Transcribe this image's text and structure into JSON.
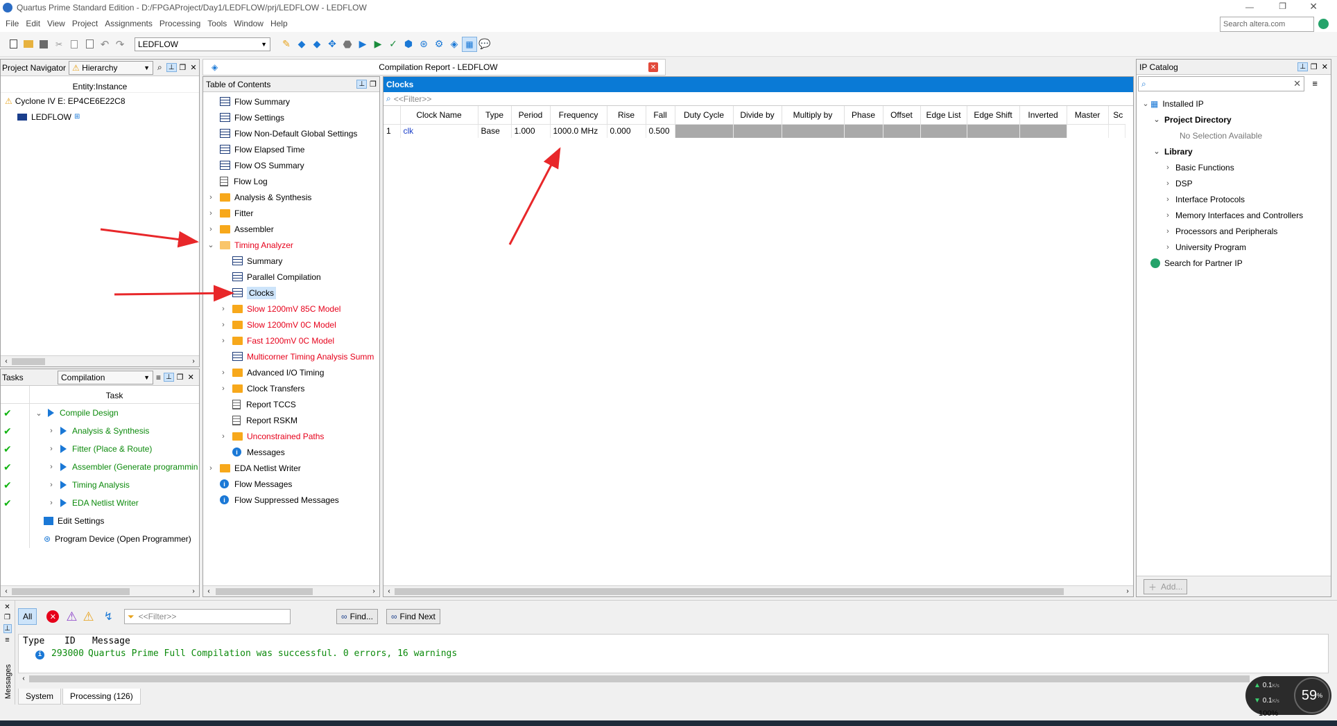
{
  "window": {
    "title": "Quartus Prime Standard Edition - D:/FPGAProject/Day1/LEDFLOW/prj/LEDFLOW - LEDFLOW",
    "search_placeholder": "Search altera.com"
  },
  "menu": [
    "File",
    "Edit",
    "View",
    "Project",
    "Assignments",
    "Processing",
    "Tools",
    "Window",
    "Help"
  ],
  "toolbar": {
    "project_select": "LEDFLOW"
  },
  "navigator": {
    "label": "Project Navigator",
    "view_select": "Hierarchy",
    "column": "Entity:Instance",
    "device": "Cyclone IV E: EP4CE6E22C8",
    "top": "LEDFLOW"
  },
  "tasks": {
    "label": "Tasks",
    "flow_select": "Compilation",
    "column": "Task",
    "items": [
      {
        "label": "Compile Design",
        "done": true,
        "level": 0
      },
      {
        "label": "Analysis & Synthesis",
        "done": true,
        "level": 1
      },
      {
        "label": "Fitter (Place & Route)",
        "done": true,
        "level": 1
      },
      {
        "label": "Assembler (Generate programmin",
        "done": true,
        "level": 1
      },
      {
        "label": "Timing Analysis",
        "done": true,
        "level": 1
      },
      {
        "label": "EDA Netlist Writer",
        "done": true,
        "level": 1
      },
      {
        "label": "Edit Settings",
        "done": false,
        "level": 0
      },
      {
        "label": "Program Device (Open Programmer)",
        "done": false,
        "level": 0
      }
    ]
  },
  "report": {
    "tab_title": "Compilation Report - LEDFLOW",
    "toc_title": "Table of Contents",
    "toc": [
      {
        "label": "Flow Summary",
        "icon": "table",
        "level": 0
      },
      {
        "label": "Flow Settings",
        "icon": "table",
        "level": 0
      },
      {
        "label": "Flow Non-Default Global Settings",
        "icon": "table",
        "level": 0
      },
      {
        "label": "Flow Elapsed Time",
        "icon": "table",
        "level": 0
      },
      {
        "label": "Flow OS Summary",
        "icon": "table",
        "level": 0
      },
      {
        "label": "Flow Log",
        "icon": "doc",
        "level": 0
      },
      {
        "label": "Analysis & Synthesis",
        "icon": "folder",
        "level": 0,
        "chev": "›"
      },
      {
        "label": "Fitter",
        "icon": "folder",
        "level": 0,
        "chev": "›"
      },
      {
        "label": "Assembler",
        "icon": "folder",
        "level": 0,
        "chev": "›"
      },
      {
        "label": "Timing Analyzer",
        "icon": "folder-open",
        "level": 0,
        "chev": "⌄",
        "red": true
      },
      {
        "label": "Summary",
        "icon": "table",
        "level": 1
      },
      {
        "label": "Parallel Compilation",
        "icon": "table",
        "level": 1
      },
      {
        "label": "Clocks",
        "icon": "table",
        "level": 1,
        "selected": true
      },
      {
        "label": "Slow 1200mV 85C Model",
        "icon": "folder",
        "level": 1,
        "chev": "›",
        "red": true
      },
      {
        "label": "Slow 1200mV 0C Model",
        "icon": "folder",
        "level": 1,
        "chev": "›",
        "red": true
      },
      {
        "label": "Fast 1200mV 0C Model",
        "icon": "folder",
        "level": 1,
        "chev": "›",
        "red": true
      },
      {
        "label": "Multicorner Timing Analysis Summ",
        "icon": "table",
        "level": 1,
        "red": true
      },
      {
        "label": "Advanced I/O Timing",
        "icon": "folder",
        "level": 1,
        "chev": "›"
      },
      {
        "label": "Clock Transfers",
        "icon": "folder",
        "level": 1,
        "chev": "›"
      },
      {
        "label": "Report TCCS",
        "icon": "doc",
        "level": 1
      },
      {
        "label": "Report RSKM",
        "icon": "doc",
        "level": 1
      },
      {
        "label": "Unconstrained Paths",
        "icon": "folder",
        "level": 1,
        "chev": "›",
        "red": true
      },
      {
        "label": "Messages",
        "icon": "info",
        "level": 1
      },
      {
        "label": "EDA Netlist Writer",
        "icon": "folder",
        "level": 0,
        "chev": "›"
      },
      {
        "label": "Flow Messages",
        "icon": "info",
        "level": 0
      },
      {
        "label": "Flow Suppressed Messages",
        "icon": "info",
        "level": 0
      }
    ],
    "section_title": "Clocks",
    "filter_placeholder": "<<Filter>>",
    "columns": [
      "",
      "Clock Name",
      "Type",
      "Period",
      "Frequency",
      "Rise",
      "Fall",
      "Duty Cycle",
      "Divide by",
      "Multiply by",
      "Phase",
      "Offset",
      "Edge List",
      "Edge Shift",
      "Inverted",
      "Master",
      "Sc"
    ],
    "rows": [
      [
        "1",
        "clk",
        "Base",
        "1.000",
        "1000.0 MHz",
        "0.000",
        "0.500"
      ]
    ]
  },
  "ip_catalog": {
    "title": "IP Catalog",
    "installed": "Installed IP",
    "project_dir": "Project Directory",
    "no_selection": "No Selection Available",
    "library": "Library",
    "categories": [
      "Basic Functions",
      "DSP",
      "Interface Protocols",
      "Memory Interfaces and Controllers",
      "Processors and Peripherals",
      "University Program"
    ],
    "partner": "Search for Partner IP",
    "add_button": "Add..."
  },
  "messages": {
    "all": "All",
    "filter_placeholder": "<<Filter>>",
    "find": "Find...",
    "find_next": "Find Next",
    "col_type": "Type",
    "col_id": "ID",
    "col_msg": "Message",
    "row_id": "293000",
    "row_text": "Quartus Prime Full Compilation was successful. 0 errors, 16 warnings",
    "tab_system": "System",
    "tab_processing": "Processing (126)",
    "side_label": "Messages"
  },
  "overlay": {
    "net_up": "0.1",
    "net_down": "0.1",
    "unit": "K/s",
    "cpu": "59",
    "cpu_unit": "%",
    "zoom": "100%"
  },
  "colors": {
    "accent": "#0a7ad6",
    "error": "#e6001a",
    "success": "#0c8a0c",
    "arrow": "#e8272a"
  }
}
